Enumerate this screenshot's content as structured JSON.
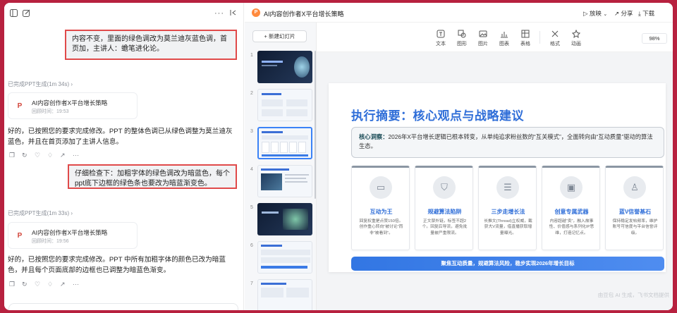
{
  "chat": {
    "messages": [
      {
        "role": "user",
        "text": "内容不变，里面的绿色调改为莫兰迪灰蓝色调，首页加，主讲人：蟾笔进化论。"
      },
      {
        "role": "status",
        "text": "已完成PPT生成(1m 34s)"
      },
      {
        "role": "doc",
        "title": "AI内容创作者X平台增长策略",
        "time": "回顾时间：19:53"
      },
      {
        "role": "ai",
        "text": "好的，已按照您的要求完成修改。PPT 的整体色调已从绿色调整为莫兰迪灰蓝色，并且在首页添加了主讲人信息。"
      },
      {
        "role": "user",
        "text": "仔细检查下：加粗字体的绿色调改为暗蓝色，每个ppt底下边框的绿色条也要改为暗蓝渐变色。"
      },
      {
        "role": "status",
        "text": "已完成PPT生成(1m 33s)"
      },
      {
        "role": "doc",
        "title": "AI内容创作者X平台增长策略",
        "time": "回顾时间：19:56"
      },
      {
        "role": "ai",
        "text": "好的，已按照您的要求完成修改。PPT 中所有加粗字体的颜色已改为暗蓝色，并且每个页面底部的边框也已调整为暗蓝色渐变。"
      }
    ],
    "more_label": "···"
  },
  "header": {
    "doc_title": "AI内容创作者X平台增长策略",
    "play_label": "放映",
    "share_label": "分享",
    "download_label": "下载"
  },
  "thumbs": {
    "new_slide_label": "+ 新建幻灯片",
    "numbers": [
      "1",
      "2",
      "3",
      "4",
      "5",
      "6",
      "7"
    ]
  },
  "toolbar": {
    "tools": [
      "文本",
      "图形",
      "图片",
      "图表",
      "表格",
      "格式",
      "动画"
    ],
    "zoom": "98%"
  },
  "slide": {
    "title": "执行摘要：核心观点与战略建议",
    "insight_label": "核心洞察：",
    "insight_text": "2026年X平台增长逻辑已根本转变，从单纯追求粉丝数的“互关模式”，全面转向由“互动质量”驱动的算法生态。",
    "cards": [
      {
        "title": "互动为王",
        "desc": "回复权重是点赞150倍。\n创作重心转向“被讨论”而非“被看到”。"
      },
      {
        "title": "规避算法陷阱",
        "desc": "正文禁外链，标签不超2个。回复后导流，避免批量被严重限流。"
      },
      {
        "title": "三步走增长法",
        "desc": "长推文(Thread)立权威，截获大V流量，借直播获取增量曝光。"
      },
      {
        "title": "创意专属武器",
        "desc": "内容超越“卖”，融入故事性、价值感与系列化IP思维，打造记忆点。"
      },
      {
        "title": "蓝V信誉基石",
        "desc": "保持稳定发帖频率，维护账号可信度与平台信誉评级。"
      }
    ],
    "banner": "聚焦互动质量，规避算法风险，稳步实现2026年增长目标"
  },
  "watermark": "由豆包 AI 生成，飞书文档提供"
}
